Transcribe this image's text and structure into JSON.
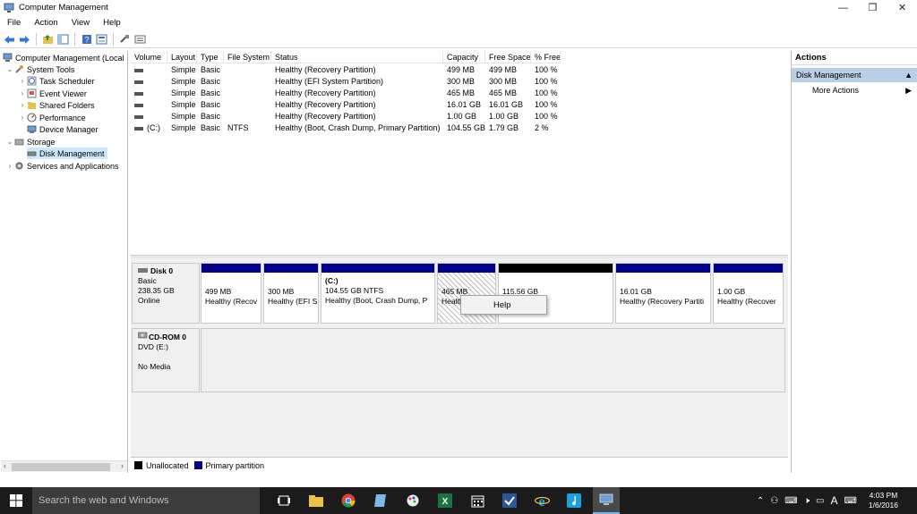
{
  "window": {
    "title": "Computer Management",
    "controls": {
      "minimize": "—",
      "restore": "❐",
      "close": "✕"
    }
  },
  "menu": [
    "File",
    "Action",
    "View",
    "Help"
  ],
  "tree": {
    "root": "Computer Management (Local",
    "system_tools": "System Tools",
    "task_scheduler": "Task Scheduler",
    "event_viewer": "Event Viewer",
    "shared_folders": "Shared Folders",
    "performance": "Performance",
    "device_manager": "Device Manager",
    "storage": "Storage",
    "disk_management": "Disk Management",
    "services": "Services and Applications"
  },
  "volumes": {
    "columns": [
      "Volume",
      "Layout",
      "Type",
      "File System",
      "Status",
      "Capacity",
      "Free Space",
      "% Free"
    ],
    "rows": [
      {
        "volume": "",
        "layout": "Simple",
        "type": "Basic",
        "fs": "",
        "status": "Healthy (Recovery Partition)",
        "capacity": "499 MB",
        "free": "499 MB",
        "pct": "100 %"
      },
      {
        "volume": "",
        "layout": "Simple",
        "type": "Basic",
        "fs": "",
        "status": "Healthy (EFI System Partition)",
        "capacity": "300 MB",
        "free": "300 MB",
        "pct": "100 %"
      },
      {
        "volume": "",
        "layout": "Simple",
        "type": "Basic",
        "fs": "",
        "status": "Healthy (Recovery Partition)",
        "capacity": "465 MB",
        "free": "465 MB",
        "pct": "100 %"
      },
      {
        "volume": "",
        "layout": "Simple",
        "type": "Basic",
        "fs": "",
        "status": "Healthy (Recovery Partition)",
        "capacity": "16.01 GB",
        "free": "16.01 GB",
        "pct": "100 %"
      },
      {
        "volume": "",
        "layout": "Simple",
        "type": "Basic",
        "fs": "",
        "status": "Healthy (Recovery Partition)",
        "capacity": "1.00 GB",
        "free": "1.00 GB",
        "pct": "100 %"
      },
      {
        "volume": "(C:)",
        "layout": "Simple",
        "type": "Basic",
        "fs": "NTFS",
        "status": "Healthy (Boot, Crash Dump, Primary Partition)",
        "capacity": "104.55 GB",
        "free": "1.79 GB",
        "pct": "2 %"
      }
    ]
  },
  "disk0": {
    "name": "Disk 0",
    "type": "Basic",
    "size": "238.35 GB",
    "state": "Online",
    "partitions": [
      {
        "l1": "",
        "l2": "499 MB",
        "l3": "Healthy (Recov"
      },
      {
        "l1": "",
        "l2": "300 MB",
        "l3": "Healthy (EFI S"
      },
      {
        "l1": "(C:)",
        "l2": "104.55 GB NTFS",
        "l3": "Healthy (Boot, Crash Dump, P"
      },
      {
        "l1": "",
        "l2": "465 MB",
        "l3": "Healthy"
      },
      {
        "l1": "",
        "l2": "115.56 GB",
        "l3": ""
      },
      {
        "l1": "",
        "l2": "16.01 GB",
        "l3": "Healthy (Recovery Partiti"
      },
      {
        "l1": "",
        "l2": "1.00 GB",
        "l3": "Healthy (Recover"
      }
    ]
  },
  "cdrom": {
    "name": "CD-ROM 0",
    "drive": "DVD (E:)",
    "media": "No Media"
  },
  "context_menu": {
    "item": "Help"
  },
  "legend": {
    "unallocated": "Unallocated",
    "primary": "Primary partition",
    "unallocated_color": "#000000",
    "primary_color": "#00008b"
  },
  "actions": {
    "header": "Actions",
    "section": "Disk Management",
    "more": "More Actions"
  },
  "taskbar": {
    "search_placeholder": "Search the web and Windows",
    "time": "4:03 PM",
    "date": "1/6/2016"
  }
}
